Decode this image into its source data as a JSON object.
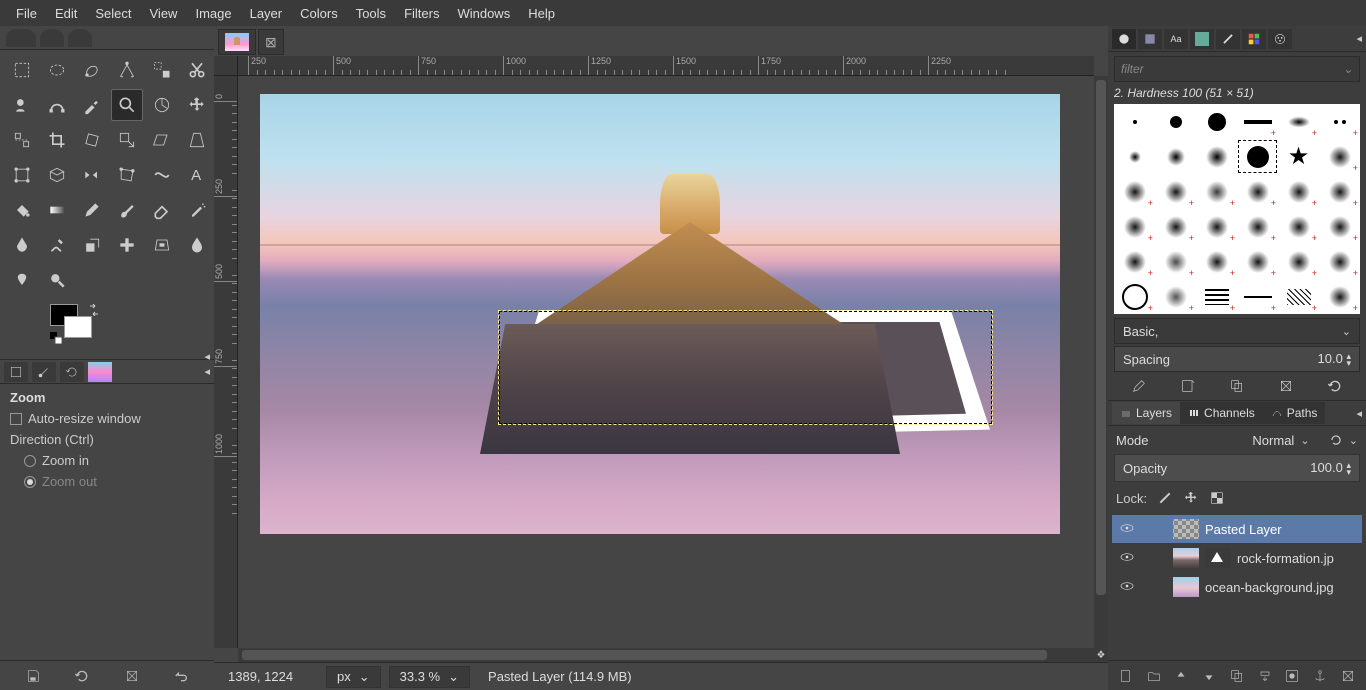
{
  "menubar": [
    "File",
    "Edit",
    "Select",
    "View",
    "Image",
    "Layer",
    "Colors",
    "Tools",
    "Filters",
    "Windows",
    "Help"
  ],
  "document": {
    "tab_has_close": true
  },
  "ruler_h": [
    "250",
    "500",
    "750",
    "1000",
    "1250",
    "1500",
    "1750",
    "2000",
    "2250"
  ],
  "ruler_v": [
    "0",
    "250",
    "500",
    "750",
    "1000"
  ],
  "tool_options": {
    "title": "Zoom",
    "auto_resize": "Auto-resize window",
    "direction_label": "Direction  (Ctrl)",
    "zoom_in": "Zoom in",
    "zoom_out": "Zoom out",
    "selected": "zoom_out"
  },
  "statusbar": {
    "coords": "1389, 1224",
    "units": "px",
    "zoom": "33.3 %",
    "layer_info": "Pasted Layer (114.9 MB)"
  },
  "right": {
    "filter_placeholder": "filter",
    "brush_label": "2. Hardness 100 (51 × 51)",
    "preset": "Basic,",
    "spacing_label": "Spacing",
    "spacing_value": "10.0",
    "layer_tabs": [
      "Layers",
      "Channels",
      "Paths"
    ],
    "mode_label": "Mode",
    "mode_value": "Normal",
    "opacity_label": "Opacity",
    "opacity_value": "100.0",
    "lock_label": "Lock:",
    "layers": [
      {
        "name": "Pasted Layer",
        "thumb": "check",
        "sel": true
      },
      {
        "name": "rock-formation.jp",
        "thumb": "mnt",
        "mask": true
      },
      {
        "name": "ocean-background.jpg",
        "thumb": "ocn"
      }
    ]
  }
}
